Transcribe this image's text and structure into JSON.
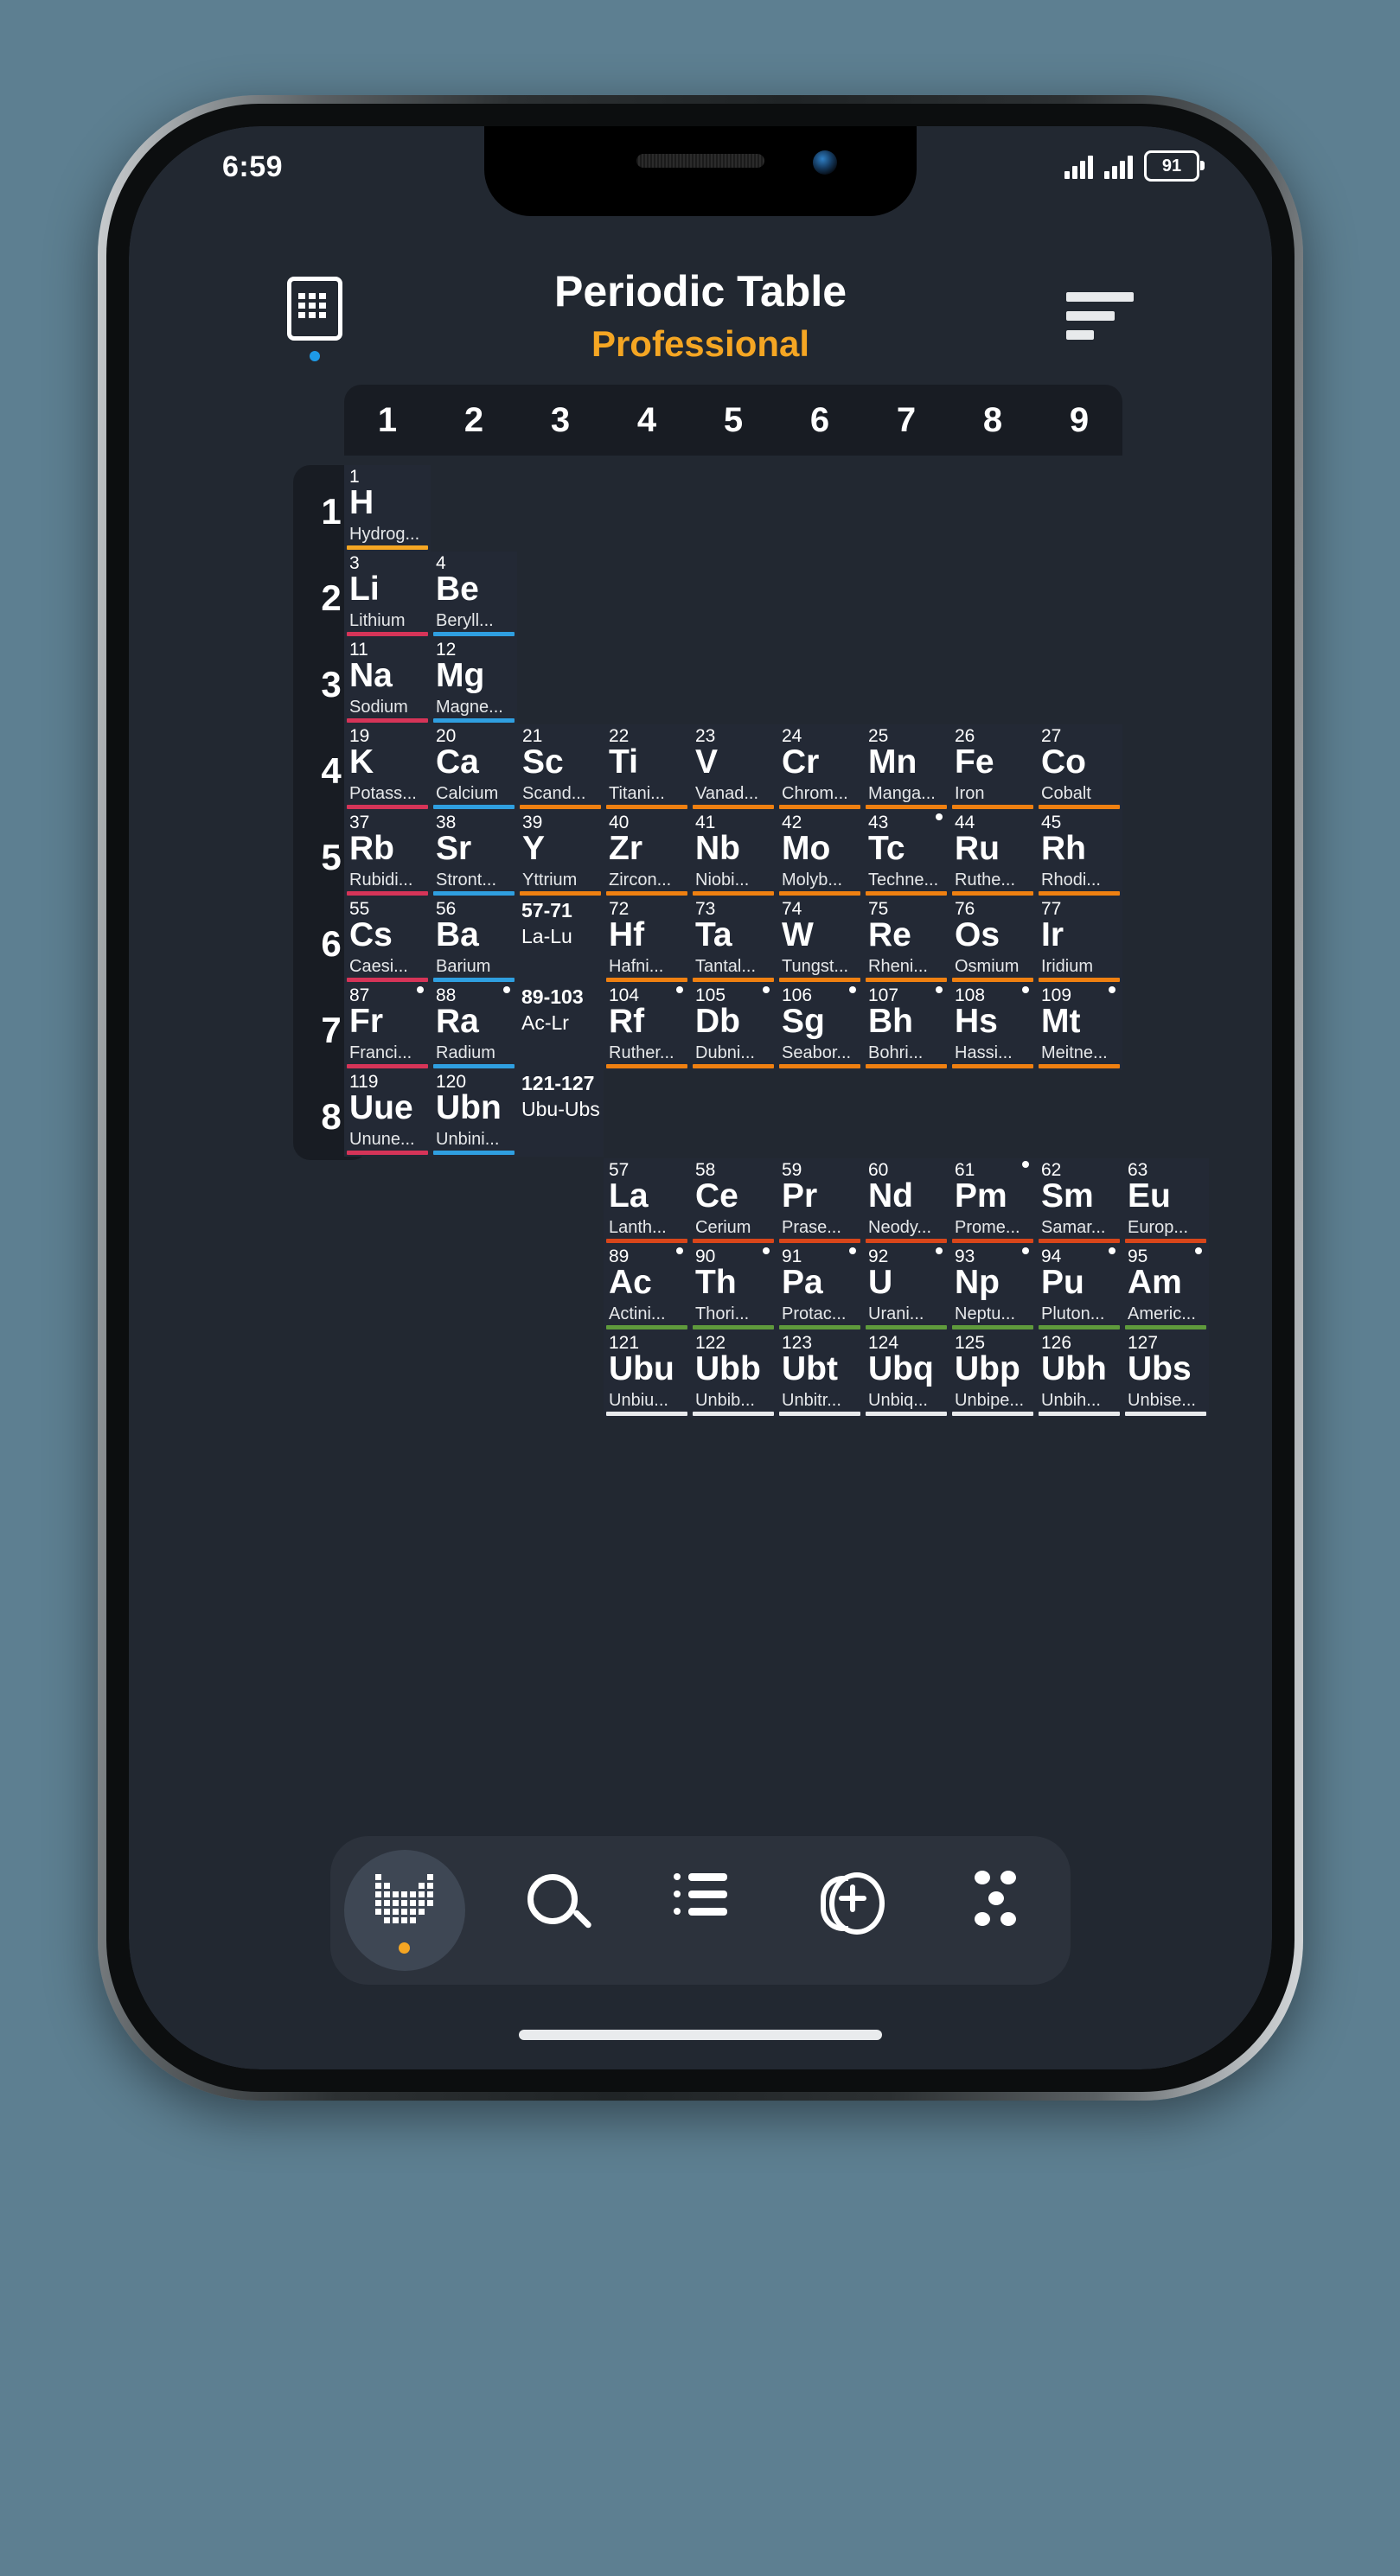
{
  "status_bar": {
    "time": "6:59",
    "battery": "91"
  },
  "header": {
    "title": "Periodic Table",
    "subtitle": "Professional",
    "grid_icon": "grid-view-icon",
    "sort_icon": "sort-icon"
  },
  "table": {
    "columns": [
      "1",
      "2",
      "3",
      "4",
      "5",
      "6",
      "7",
      "8",
      "9"
    ],
    "rows": [
      "1",
      "2",
      "3",
      "4",
      "5",
      "6",
      "7",
      "8"
    ],
    "category_colors": {
      "nonmetal": "#f5a623",
      "alkali": "#d63458",
      "alkaline": "#2f9fe0",
      "transition": "#ef8011",
      "lanthanide": "#d9461a",
      "actinide": "#5f9a3c",
      "unknown": "#e8eaec"
    },
    "main": [
      [
        {
          "n": "1",
          "s": "H",
          "name": "Hydrog...",
          "cat": "nonmetal"
        },
        null,
        null,
        null,
        null,
        null,
        null,
        null,
        null
      ],
      [
        {
          "n": "3",
          "s": "Li",
          "name": "Lithium",
          "cat": "alkali"
        },
        {
          "n": "4",
          "s": "Be",
          "name": "Beryll...",
          "cat": "alkaline"
        },
        null,
        null,
        null,
        null,
        null,
        null,
        null
      ],
      [
        {
          "n": "11",
          "s": "Na",
          "name": "Sodium",
          "cat": "alkali"
        },
        {
          "n": "12",
          "s": "Mg",
          "name": "Magne...",
          "cat": "alkaline"
        },
        null,
        null,
        null,
        null,
        null,
        null,
        null
      ],
      [
        {
          "n": "19",
          "s": "K",
          "name": "Potass...",
          "cat": "alkali"
        },
        {
          "n": "20",
          "s": "Ca",
          "name": "Calcium",
          "cat": "alkaline"
        },
        {
          "n": "21",
          "s": "Sc",
          "name": "Scand...",
          "cat": "transition"
        },
        {
          "n": "22",
          "s": "Ti",
          "name": "Titani...",
          "cat": "transition"
        },
        {
          "n": "23",
          "s": "V",
          "name": "Vanad...",
          "cat": "transition"
        },
        {
          "n": "24",
          "s": "Cr",
          "name": "Chrom...",
          "cat": "transition"
        },
        {
          "n": "25",
          "s": "Mn",
          "name": "Manga...",
          "cat": "transition"
        },
        {
          "n": "26",
          "s": "Fe",
          "name": "Iron",
          "cat": "transition"
        },
        {
          "n": "27",
          "s": "Co",
          "name": "Cobalt",
          "cat": "transition"
        }
      ],
      [
        {
          "n": "37",
          "s": "Rb",
          "name": "Rubidi...",
          "cat": "alkali"
        },
        {
          "n": "38",
          "s": "Sr",
          "name": "Stront...",
          "cat": "alkaline"
        },
        {
          "n": "39",
          "s": "Y",
          "name": "Yttrium",
          "cat": "transition"
        },
        {
          "n": "40",
          "s": "Zr",
          "name": "Zircon...",
          "cat": "transition"
        },
        {
          "n": "41",
          "s": "Nb",
          "name": "Niobi...",
          "cat": "transition"
        },
        {
          "n": "42",
          "s": "Mo",
          "name": "Molyb...",
          "cat": "transition"
        },
        {
          "n": "43",
          "s": "Tc",
          "name": "Techne...",
          "cat": "transition",
          "rad": true
        },
        {
          "n": "44",
          "s": "Ru",
          "name": "Ruthe...",
          "cat": "transition"
        },
        {
          "n": "45",
          "s": "Rh",
          "name": "Rhodi...",
          "cat": "transition"
        }
      ],
      [
        {
          "n": "55",
          "s": "Cs",
          "name": "Caesi...",
          "cat": "alkali"
        },
        {
          "n": "56",
          "s": "Ba",
          "name": "Barium",
          "cat": "alkaline"
        },
        {
          "n": "57-71",
          "s": "La-Lu",
          "placeholder": true
        },
        {
          "n": "72",
          "s": "Hf",
          "name": "Hafni...",
          "cat": "transition"
        },
        {
          "n": "73",
          "s": "Ta",
          "name": "Tantal...",
          "cat": "transition"
        },
        {
          "n": "74",
          "s": "W",
          "name": "Tungst...",
          "cat": "transition"
        },
        {
          "n": "75",
          "s": "Re",
          "name": "Rheni...",
          "cat": "transition"
        },
        {
          "n": "76",
          "s": "Os",
          "name": "Osmium",
          "cat": "transition"
        },
        {
          "n": "77",
          "s": "Ir",
          "name": "Iridium",
          "cat": "transition"
        }
      ],
      [
        {
          "n": "87",
          "s": "Fr",
          "name": "Franci...",
          "cat": "alkali",
          "rad": true
        },
        {
          "n": "88",
          "s": "Ra",
          "name": "Radium",
          "cat": "alkaline",
          "rad": true
        },
        {
          "n": "89-103",
          "s": "Ac-Lr",
          "placeholder": true
        },
        {
          "n": "104",
          "s": "Rf",
          "name": "Ruther...",
          "cat": "transition",
          "rad": true
        },
        {
          "n": "105",
          "s": "Db",
          "name": "Dubni...",
          "cat": "transition",
          "rad": true
        },
        {
          "n": "106",
          "s": "Sg",
          "name": "Seabor...",
          "cat": "transition",
          "rad": true
        },
        {
          "n": "107",
          "s": "Bh",
          "name": "Bohri...",
          "cat": "transition",
          "rad": true
        },
        {
          "n": "108",
          "s": "Hs",
          "name": "Hassi...",
          "cat": "transition",
          "rad": true
        },
        {
          "n": "109",
          "s": "Mt",
          "name": "Meitne...",
          "cat": "transition",
          "rad": true
        }
      ],
      [
        {
          "n": "119",
          "s": "Uue",
          "name": "Unune...",
          "cat": "alkali"
        },
        {
          "n": "120",
          "s": "Ubn",
          "name": "Unbini...",
          "cat": "alkaline"
        },
        {
          "n": "121-127",
          "s": "Ubu-Ubs",
          "placeholder": true
        },
        null,
        null,
        null,
        null,
        null,
        null
      ]
    ],
    "fblock": [
      [
        {
          "n": "57",
          "s": "La",
          "name": "Lanth...",
          "cat": "lanthanide"
        },
        {
          "n": "58",
          "s": "Ce",
          "name": "Cerium",
          "cat": "lanthanide"
        },
        {
          "n": "59",
          "s": "Pr",
          "name": "Prase...",
          "cat": "lanthanide"
        },
        {
          "n": "60",
          "s": "Nd",
          "name": "Neody...",
          "cat": "lanthanide"
        },
        {
          "n": "61",
          "s": "Pm",
          "name": "Prome...",
          "cat": "lanthanide",
          "rad": true
        },
        {
          "n": "62",
          "s": "Sm",
          "name": "Samar...",
          "cat": "lanthanide"
        },
        {
          "n": "63",
          "s": "Eu",
          "name": "Europ...",
          "cat": "lanthanide"
        }
      ],
      [
        {
          "n": "89",
          "s": "Ac",
          "name": "Actini...",
          "cat": "actinide",
          "rad": true
        },
        {
          "n": "90",
          "s": "Th",
          "name": "Thori...",
          "cat": "actinide",
          "rad": true
        },
        {
          "n": "91",
          "s": "Pa",
          "name": "Protac...",
          "cat": "actinide",
          "rad": true
        },
        {
          "n": "92",
          "s": "U",
          "name": "Urani...",
          "cat": "actinide",
          "rad": true
        },
        {
          "n": "93",
          "s": "Np",
          "name": "Neptu...",
          "cat": "actinide",
          "rad": true
        },
        {
          "n": "94",
          "s": "Pu",
          "name": "Pluton...",
          "cat": "actinide",
          "rad": true
        },
        {
          "n": "95",
          "s": "Am",
          "name": "Americ...",
          "cat": "actinide",
          "rad": true
        }
      ],
      [
        {
          "n": "121",
          "s": "Ubu",
          "name": "Unbiu...",
          "cat": "unknown"
        },
        {
          "n": "122",
          "s": "Ubb",
          "name": "Unbib...",
          "cat": "unknown"
        },
        {
          "n": "123",
          "s": "Ubt",
          "name": "Unbitr...",
          "cat": "unknown"
        },
        {
          "n": "124",
          "s": "Ubq",
          "name": "Unbiq...",
          "cat": "unknown"
        },
        {
          "n": "125",
          "s": "Ubp",
          "name": "Unbipe...",
          "cat": "unknown"
        },
        {
          "n": "126",
          "s": "Ubh",
          "name": "Unbih...",
          "cat": "unknown"
        },
        {
          "n": "127",
          "s": "Ubs",
          "name": "Unbise...",
          "cat": "unknown"
        }
      ]
    ]
  },
  "bottom_nav": {
    "items": [
      {
        "icon": "periodic-table-icon",
        "active": true
      },
      {
        "icon": "search-icon",
        "active": false
      },
      {
        "icon": "list-icon",
        "active": false
      },
      {
        "icon": "atom-plus-icon",
        "active": false
      },
      {
        "icon": "molecules-dots-icon",
        "active": false
      }
    ]
  }
}
